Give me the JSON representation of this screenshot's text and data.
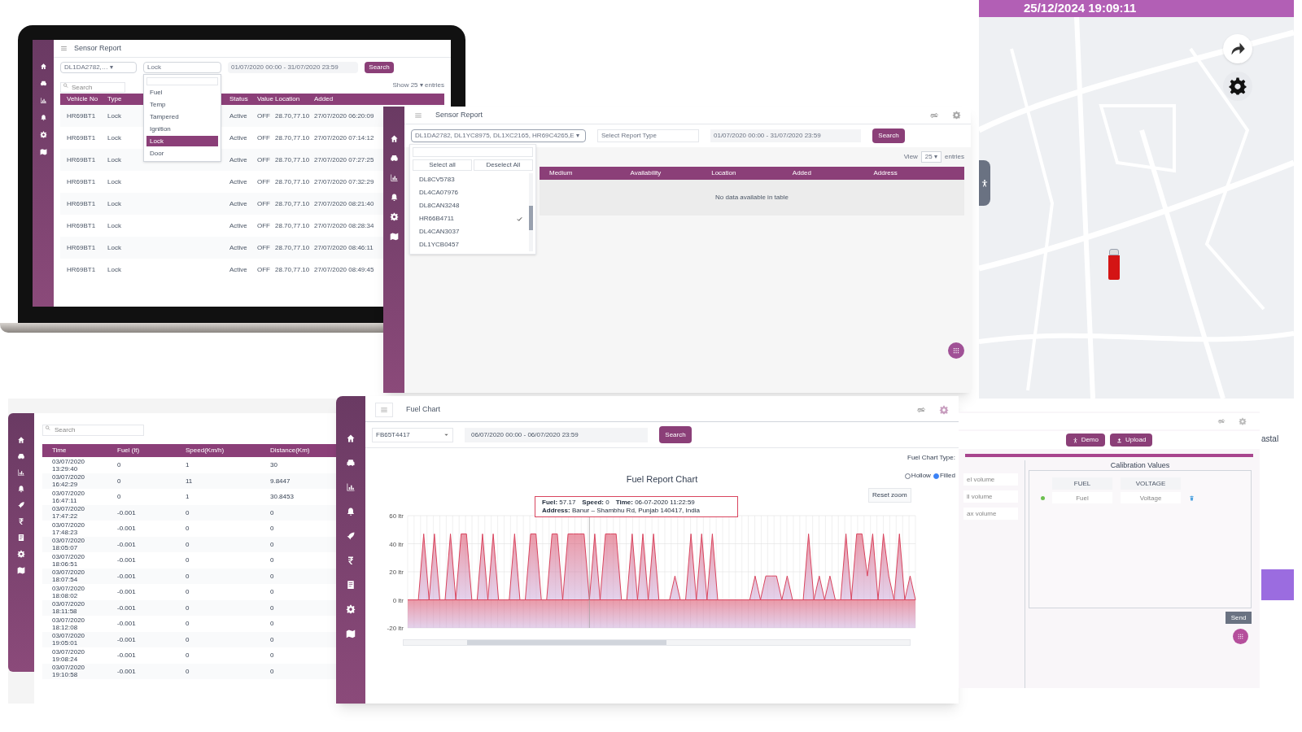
{
  "laptop_screen": {
    "title": "Sensor Report",
    "vehicle_select": "DL1DA2782,… ▾",
    "type_select": "Lock",
    "date_range": "01/07/2020 00:00 - 31/07/2020 23:59",
    "search_button": "Search",
    "search": {
      "placeholder": "Search"
    },
    "show_label": "Show 25 ▾ entries",
    "type_options": [
      {
        "label": "Fuel",
        "selected": false
      },
      {
        "label": "Temp",
        "selected": false
      },
      {
        "label": "Tampered",
        "selected": false
      },
      {
        "label": "Ignition",
        "selected": false
      },
      {
        "label": "Lock",
        "selected": true
      },
      {
        "label": "Door",
        "selected": false
      }
    ],
    "table": {
      "columns": [
        "Vehicle No",
        "Type",
        "Status",
        "Value",
        "Location",
        "Added"
      ],
      "rows": [
        [
          "HR69BT1",
          "Lock",
          "Active",
          "OFF",
          "28.70,77.10",
          "27/07/2020 06:20:09"
        ],
        [
          "HR69BT1",
          "Lock",
          "Active",
          "OFF",
          "28.70,77.10",
          "27/07/2020 07:14:12"
        ],
        [
          "HR69BT1",
          "Lock",
          "Active",
          "OFF",
          "28.70,77.10",
          "27/07/2020 07:27:25"
        ],
        [
          "HR69BT1",
          "Lock",
          "Active",
          "OFF",
          "28.70,77.10",
          "27/07/2020 07:32:29"
        ],
        [
          "HR69BT1",
          "Lock",
          "Active",
          "OFF",
          "28.70,77.10",
          "27/07/2020 08:21:40"
        ],
        [
          "HR69BT1",
          "Lock",
          "Active",
          "OFF",
          "28.70,77.10",
          "27/07/2020 08:28:34"
        ],
        [
          "HR69BT1",
          "Lock",
          "Active",
          "OFF",
          "28.70,77.10",
          "27/07/2020 08:46:11"
        ],
        [
          "HR69BT1",
          "Lock",
          "Active",
          "OFF",
          "28.70,77.10",
          "27/07/2020 08:49:45"
        ]
      ]
    }
  },
  "sensor_report": {
    "title": "Sensor Report",
    "vehicle_select": "DL1DA2782, DL1YC8975, DL1XC2165, HR69C4265,E ▾",
    "report_type_placeholder": "Select Report Type",
    "date_range": "01/07/2020 00:00 - 31/07/2020 23:59",
    "search_button": "Search",
    "select_all": "Select all",
    "deselect_all": "Deselect All",
    "vehicles": [
      {
        "label": "DL8CV5783",
        "checked": false
      },
      {
        "label": "DL4CA07976",
        "checked": false
      },
      {
        "label": "DL8CAN3248",
        "checked": false
      },
      {
        "label": "HR66B4711",
        "checked": true
      },
      {
        "label": "DL4CAN3037",
        "checked": false
      },
      {
        "label": "DL1YCB0457",
        "checked": false
      }
    ],
    "show_label": "View",
    "page_size": "25 ▾",
    "entries_label": "entries",
    "columns": [
      "Medium",
      "Availability",
      "Location",
      "Added",
      "Address"
    ],
    "empty_message": "No data available in table"
  },
  "map_view": {
    "datetime": "25/12/2024 19:09:11"
  },
  "trip_table": {
    "search": {
      "placeholder": "Search"
    },
    "columns": [
      "Time",
      "Fuel (lt)",
      "Speed(Km/h)",
      "Distance(Km)"
    ],
    "rows": [
      [
        "03/07/2020 13:29:40",
        "0",
        "1",
        "30"
      ],
      [
        "03/07/2020 16:42:29",
        "0",
        "11",
        "9.8447"
      ],
      [
        "03/07/2020 16:47:11",
        "0",
        "1",
        "30.8453"
      ],
      [
        "03/07/2020 17:47:22",
        "-0.001",
        "0",
        "0"
      ],
      [
        "03/07/2020 17:48:23",
        "-0.001",
        "0",
        "0"
      ],
      [
        "03/07/2020 18:05:07",
        "-0.001",
        "0",
        "0"
      ],
      [
        "03/07/2020 18:06:51",
        "-0.001",
        "0",
        "0"
      ],
      [
        "03/07/2020 18:07:54",
        "-0.001",
        "0",
        "0"
      ],
      [
        "03/07/2020 18:08:02",
        "-0.001",
        "0",
        "0"
      ],
      [
        "03/07/2020 18:11:58",
        "-0.001",
        "0",
        "0"
      ],
      [
        "03/07/2020 18:12:08",
        "-0.001",
        "0",
        "0"
      ],
      [
        "03/07/2020 19:05:01",
        "-0.001",
        "0",
        "0"
      ],
      [
        "03/07/2020 19:08:24",
        "-0.001",
        "0",
        "0"
      ],
      [
        "03/07/2020 19:10:58",
        "-0.001",
        "0",
        "0"
      ]
    ]
  },
  "fuel_chart": {
    "title": "Fuel Chart",
    "vehicle": "FB65T4417",
    "date_range": "06/07/2020 00:00 - 06/07/2020 23:59",
    "search_button": "Search",
    "chart_type_label": "Fuel Chart Type:",
    "chart_types": [
      {
        "label": "Hollow",
        "selected": false
      },
      {
        "label": "Filled",
        "selected": true
      }
    ],
    "reset_zoom": "Reset zoom",
    "tooltip": [
      "**Fuel:** 57.17",
      "**Speed:** 0",
      "**Time:** 06-07-2020 11:22:59",
      "**Address:** Banur – Shambhu Rd, Punjab 140417, India"
    ],
    "chart_data": {
      "type": "area",
      "title": "Fuel Report Chart",
      "grid": true,
      "ylim": [
        -20,
        60
      ],
      "yticks": [
        {
          "value": 60,
          "label": "60 ltr"
        },
        {
          "value": 40,
          "label": "40 ltr"
        },
        {
          "value": 20,
          "label": "20 ltr"
        },
        {
          "value": 0,
          "label": "0 ltr"
        },
        {
          "value": -20,
          "label": "-20 ltr"
        }
      ],
      "series": [
        {
          "color": "#d9455f",
          "values": [
            0,
            0,
            0,
            47,
            0,
            47,
            0,
            0,
            47,
            0,
            47,
            47,
            0,
            0,
            47,
            0,
            47,
            0,
            0,
            0,
            47,
            0,
            0,
            47,
            47,
            0,
            0,
            47,
            47,
            0,
            47,
            47,
            47,
            47,
            0,
            47,
            0,
            47,
            47,
            47,
            0,
            0,
            47,
            0,
            47,
            0,
            47,
            0,
            0,
            0,
            17,
            0,
            0,
            47,
            0,
            47,
            0,
            47,
            0,
            0,
            0,
            0,
            0,
            0,
            0,
            17,
            0,
            17,
            17,
            17,
            0,
            17,
            0,
            0,
            0,
            47,
            0,
            17,
            0,
            17,
            0,
            0,
            47,
            0,
            47,
            47,
            17,
            47,
            0,
            47,
            17,
            0,
            47,
            0,
            17,
            0
          ]
        }
      ]
    }
  },
  "calibration": {
    "buttons": [
      "Demo",
      "Upload"
    ],
    "fields": [
      {
        "placeholder": "el volume"
      },
      {
        "placeholder": "ll volume"
      },
      {
        "placeholder": "ax volume"
      }
    ],
    "title": "Calibration Values",
    "columns": [
      "FUEL",
      "VOLTAGE"
    ],
    "row_fields": [
      {
        "placeholder": "Fuel"
      },
      {
        "placeholder": "Voltage"
      }
    ],
    "send_button": "Send"
  },
  "side_text": "astal"
}
